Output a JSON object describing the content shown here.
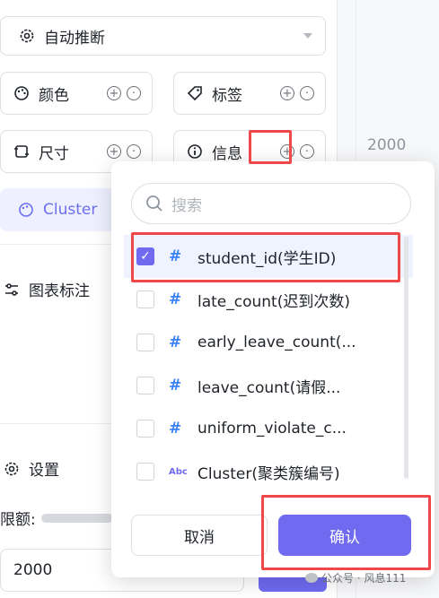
{
  "auto_infer": {
    "label": "自动推断"
  },
  "encodings": {
    "color": "颜色",
    "tag": "标签",
    "size": "尺寸",
    "info": "信息",
    "cluster_chip": "Cluster"
  },
  "sections": {
    "annotation": "图表标注",
    "settings": "设置",
    "limit_label": "限额:",
    "limit_value": "2000"
  },
  "background": {
    "value": "2000"
  },
  "popup": {
    "search_placeholder": "搜索",
    "fields": [
      {
        "name": "student_id(学生ID)",
        "type": "number",
        "checked": true
      },
      {
        "name": "late_count(迟到次数)",
        "type": "number",
        "checked": false
      },
      {
        "name": "early_leave_count(...",
        "type": "number",
        "checked": false
      },
      {
        "name": "leave_count(请假...",
        "type": "number",
        "checked": false
      },
      {
        "name": "uniform_violate_c...",
        "type": "number",
        "checked": false
      },
      {
        "name": "Cluster(聚类簇编号)",
        "type": "text",
        "checked": false
      }
    ],
    "type_badge_text": "Abc",
    "cancel": "取消",
    "confirm": "确认"
  },
  "watermark": {
    "text": "公众号 · 风息111"
  },
  "colors": {
    "accent": "#6f6af0",
    "highlight": "#f04848",
    "number_type": "#3b82f6"
  }
}
